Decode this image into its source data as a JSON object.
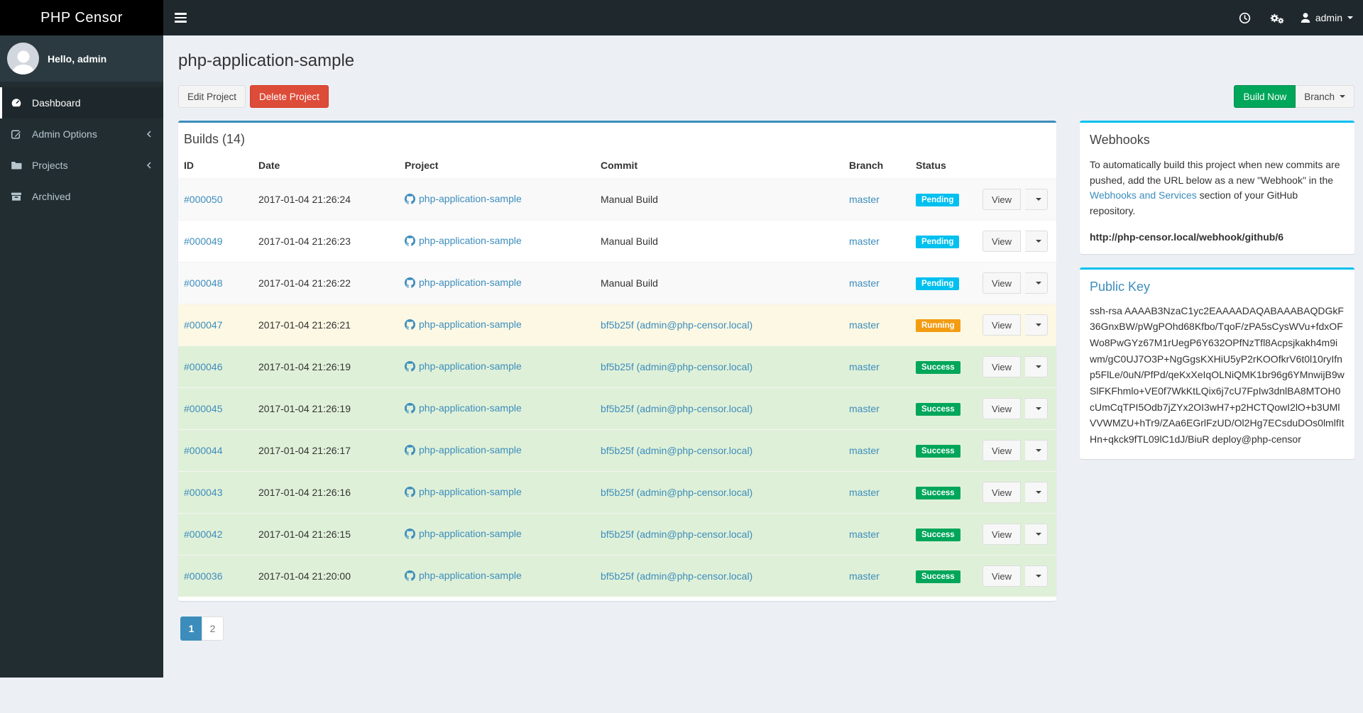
{
  "app": {
    "logo": "PHP Censor"
  },
  "navbar": {
    "hamburger_icon": "bars-icon",
    "right_icons": [
      "clock-icon",
      "gears-icon"
    ],
    "user": {
      "icon": "user-icon",
      "name": "admin",
      "caret": "caret-down-icon"
    }
  },
  "sidebar": {
    "greeting": "Hello, admin",
    "avatar_icon": "user-avatar",
    "items": [
      {
        "label": "Dashboard",
        "icon": "dashboard-icon",
        "active": true,
        "chevron": false
      },
      {
        "label": "Admin Options",
        "icon": "edit-icon",
        "active": false,
        "chevron": true
      },
      {
        "label": "Projects",
        "icon": "folder-icon",
        "active": false,
        "chevron": true
      },
      {
        "label": "Archived",
        "icon": "archive-icon",
        "active": false,
        "chevron": false
      }
    ]
  },
  "page": {
    "title": "php-application-sample",
    "actions": {
      "edit": "Edit Project",
      "delete": "Delete Project",
      "build": "Build Now",
      "branch": "Branch"
    }
  },
  "builds": {
    "panel_title": "Builds (14)",
    "columns": [
      "ID",
      "Date",
      "Project",
      "Commit",
      "Branch",
      "Status",
      ""
    ],
    "view_label": "View",
    "rows": [
      {
        "id": "#000050",
        "date": "2017-01-04 21:26:24",
        "project": "php-application-sample",
        "commit": "Manual Build",
        "commit_is_link": false,
        "branch": "master",
        "status": "Pending"
      },
      {
        "id": "#000049",
        "date": "2017-01-04 21:26:23",
        "project": "php-application-sample",
        "commit": "Manual Build",
        "commit_is_link": false,
        "branch": "master",
        "status": "Pending"
      },
      {
        "id": "#000048",
        "date": "2017-01-04 21:26:22",
        "project": "php-application-sample",
        "commit": "Manual Build",
        "commit_is_link": false,
        "branch": "master",
        "status": "Pending"
      },
      {
        "id": "#000047",
        "date": "2017-01-04 21:26:21",
        "project": "php-application-sample",
        "commit": "bf5b25f (admin@php-censor.local)",
        "commit_is_link": true,
        "branch": "master",
        "status": "Running"
      },
      {
        "id": "#000046",
        "date": "2017-01-04 21:26:19",
        "project": "php-application-sample",
        "commit": "bf5b25f (admin@php-censor.local)",
        "commit_is_link": true,
        "branch": "master",
        "status": "Success"
      },
      {
        "id": "#000045",
        "date": "2017-01-04 21:26:19",
        "project": "php-application-sample",
        "commit": "bf5b25f (admin@php-censor.local)",
        "commit_is_link": true,
        "branch": "master",
        "status": "Success"
      },
      {
        "id": "#000044",
        "date": "2017-01-04 21:26:17",
        "project": "php-application-sample",
        "commit": "bf5b25f (admin@php-censor.local)",
        "commit_is_link": true,
        "branch": "master",
        "status": "Success"
      },
      {
        "id": "#000043",
        "date": "2017-01-04 21:26:16",
        "project": "php-application-sample",
        "commit": "bf5b25f (admin@php-censor.local)",
        "commit_is_link": true,
        "branch": "master",
        "status": "Success"
      },
      {
        "id": "#000042",
        "date": "2017-01-04 21:26:15",
        "project": "php-application-sample",
        "commit": "bf5b25f (admin@php-censor.local)",
        "commit_is_link": true,
        "branch": "master",
        "status": "Success"
      },
      {
        "id": "#000036",
        "date": "2017-01-04 21:20:00",
        "project": "php-application-sample",
        "commit": "bf5b25f (admin@php-censor.local)",
        "commit_is_link": true,
        "branch": "master",
        "status": "Success"
      }
    ]
  },
  "pagination": {
    "pages": [
      {
        "label": "1",
        "active": true
      },
      {
        "label": "2",
        "active": false
      }
    ]
  },
  "webhooks": {
    "title": "Webhooks",
    "text_before": "To automatically build this project when new commits are pushed, add the URL below as a new \"Webhook\" in the ",
    "link": "Webhooks and Services",
    "text_after": " section of your GitHub repository.",
    "url": "http://php-censor.local/webhook/github/6"
  },
  "public_key": {
    "title": "Public Key",
    "key": "ssh-rsa AAAAB3NzaC1yc2EAAAADAQABAAABAQDGkF36GnxBW/pWgPOhd68Kfbo/TqoF/zPA5sCysWVu+fdxOFWo8PwGYz67M1rUegP6Y632OPfNzTfl8Acpsjkakh4m9iwm/gC0UJ7O3P+NgGgsKXHiU5yP2rKOOfkrV6t0l10ryIfnp5FlLe/0uN/PfPd/qeKxXeIqOLNiQMK1br96g6YMnwijB9wSlFKFhmlo+VE0f7WkKtLQix6j7cU7FpIw3dnlBA8MTOH0cUmCqTPI5Odb7jZYx2OI3wH7+p2HCTQowI2lO+b3UMlVVWMZU+hTr9/ZAa6EGrlFzUD/Ol2Hg7ECsduDOs0lmlfItHn+qkck9fTL09lC1dJ/BiuR deploy@php-censor"
  },
  "colors": {
    "accent": "#3c8dbc",
    "info": "#00c0ef",
    "success": "#00a65a",
    "warning": "#f39c12",
    "danger": "#dd4b39",
    "status": {
      "Pending": "#00c0ef",
      "Running": "#f39c12",
      "Success": "#00a65a"
    }
  }
}
